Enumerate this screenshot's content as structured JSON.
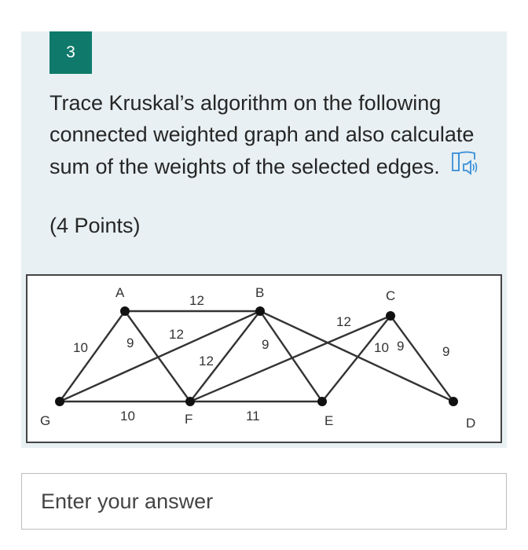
{
  "question": {
    "number": "3",
    "text": "Trace Kruskal’s algorithm on the following connected weighted graph and also calculate sum of the weights of the selected edges.",
    "points": "(4 Points)"
  },
  "graph": {
    "nodes": [
      {
        "id": "A",
        "label": "A"
      },
      {
        "id": "B",
        "label": "B"
      },
      {
        "id": "C",
        "label": "C"
      },
      {
        "id": "D",
        "label": "D"
      },
      {
        "id": "E",
        "label": "E"
      },
      {
        "id": "F",
        "label": "F"
      },
      {
        "id": "G",
        "label": "G"
      }
    ],
    "edges": [
      {
        "from": "A",
        "to": "B",
        "weight": "12"
      },
      {
        "from": "A",
        "to": "G",
        "weight": "10"
      },
      {
        "from": "A",
        "to": "F",
        "weight": "9"
      },
      {
        "from": "G",
        "to": "B",
        "weight": "12"
      },
      {
        "from": "G",
        "to": "F",
        "weight": "10"
      },
      {
        "from": "B",
        "to": "F",
        "weight": "12"
      },
      {
        "from": "B",
        "to": "E",
        "weight": "9"
      },
      {
        "from": "B",
        "to": "D",
        "weight": "10"
      },
      {
        "from": "F",
        "to": "C",
        "weight": "12"
      },
      {
        "from": "F",
        "to": "E",
        "weight": "11"
      },
      {
        "from": "C",
        "to": "E",
        "weight": "9"
      },
      {
        "from": "C",
        "to": "D",
        "weight": "9"
      }
    ]
  },
  "answer": {
    "placeholder": "Enter your answer"
  },
  "colors": {
    "badge": "#0f7a6b",
    "card_background": "#e8f0f3",
    "reader_icon": "#3a8fd8"
  },
  "icons": {
    "reader": "immersive-reader-icon"
  }
}
